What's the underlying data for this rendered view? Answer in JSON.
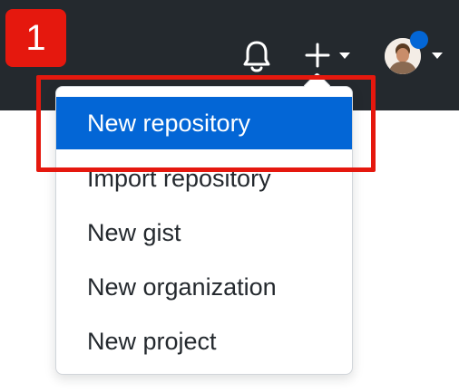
{
  "annotation": {
    "step_number": "1",
    "badge_color": "#e5180e",
    "highlight_color": "#e5180e"
  },
  "header": {
    "background": "#24292e",
    "icons": [
      "bell-icon",
      "plus-icon",
      "caret-down-icon",
      "avatar",
      "caret-down-icon"
    ],
    "notification_dot_color": "#0366d6"
  },
  "dropdown": {
    "items": [
      {
        "label": "New repository",
        "active": true
      },
      {
        "label": "Import repository",
        "active": false
      },
      {
        "label": "New gist",
        "active": false
      },
      {
        "label": "New organization",
        "active": false
      },
      {
        "label": "New project",
        "active": false
      }
    ],
    "active_color": "#0366d6"
  }
}
